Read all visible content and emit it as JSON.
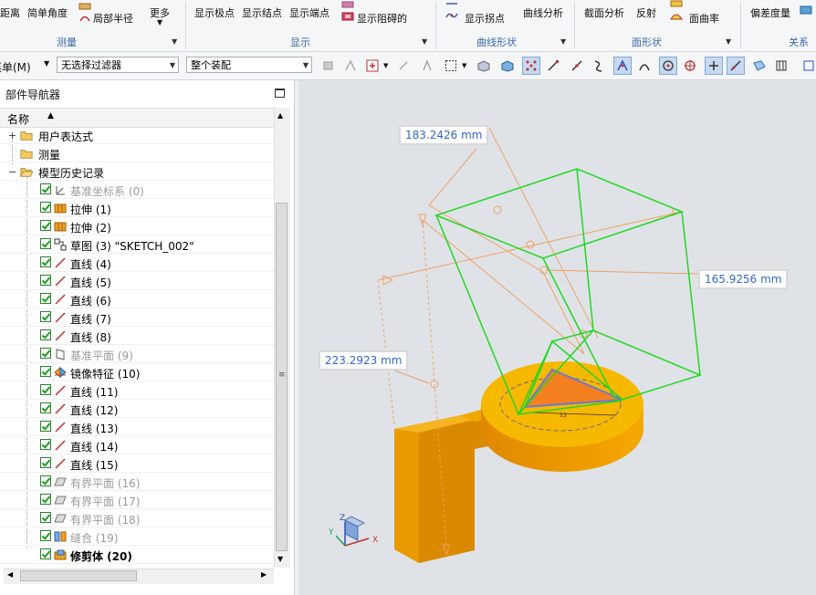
{
  "ribbon": {
    "col1": [
      "距离",
      "简单角度"
    ],
    "col2": [
      "局部半径"
    ],
    "more": "更多",
    "display_items": [
      "显示极点",
      "显示结点",
      "显示端点"
    ],
    "display_extra": "显示阻碍的",
    "curve_items": [
      "显示拐点",
      "曲线分析"
    ],
    "face_items": [
      "截面分析",
      "反射",
      "面曲率"
    ],
    "right_items": [
      "偏差度量"
    ],
    "groups": [
      "测量",
      "显示",
      "曲线形状",
      "面形状",
      "关系"
    ]
  },
  "toolbar": {
    "menu_label": "菜单(M)",
    "filter_value": "无选择过滤器",
    "assembly_value": "整个装配"
  },
  "navigator": {
    "title": "部件导航器",
    "column_name": "名称",
    "top_items": [
      {
        "label": "用户表达式"
      },
      {
        "label": "测量"
      },
      {
        "label": "模型历史记录"
      }
    ],
    "features": [
      {
        "label": "基准坐标系 (0)",
        "icon": "datum-csys-icon",
        "state": "grey"
      },
      {
        "label": "拉伸 (1)",
        "icon": "extrude-icon",
        "state": "normal"
      },
      {
        "label": "拉伸 (2)",
        "icon": "extrude-icon",
        "state": "normal"
      },
      {
        "label": "草图 (3) \"SKETCH_002\"",
        "icon": "sketch-icon",
        "state": "normal"
      },
      {
        "label": "直线 (4)",
        "icon": "line-icon",
        "state": "normal"
      },
      {
        "label": "直线 (5)",
        "icon": "line-icon",
        "state": "normal"
      },
      {
        "label": "直线 (6)",
        "icon": "line-icon",
        "state": "normal"
      },
      {
        "label": "直线 (7)",
        "icon": "line-icon",
        "state": "normal"
      },
      {
        "label": "直线 (8)",
        "icon": "line-icon",
        "state": "normal"
      },
      {
        "label": "基准平面 (9)",
        "icon": "datum-plane-icon",
        "state": "grey"
      },
      {
        "label": "镜像特征 (10)",
        "icon": "mirror-feature-icon",
        "state": "normal"
      },
      {
        "label": "直线 (11)",
        "icon": "line-icon",
        "state": "normal"
      },
      {
        "label": "直线 (12)",
        "icon": "line-icon",
        "state": "normal"
      },
      {
        "label": "直线 (13)",
        "icon": "line-icon",
        "state": "normal"
      },
      {
        "label": "直线 (14)",
        "icon": "line-icon",
        "state": "normal"
      },
      {
        "label": "直线 (15)",
        "icon": "line-icon",
        "state": "normal"
      },
      {
        "label": "有界平面 (16)",
        "icon": "bounded-plane-icon",
        "state": "grey"
      },
      {
        "label": "有界平面 (17)",
        "icon": "bounded-plane-icon",
        "state": "grey"
      },
      {
        "label": "有界平面 (18)",
        "icon": "bounded-plane-icon",
        "state": "grey"
      },
      {
        "label": "缝合 (19)",
        "icon": "sew-icon",
        "state": "grey"
      },
      {
        "label": "修剪体 (20)",
        "icon": "trim-body-icon",
        "state": "bold"
      }
    ]
  },
  "viewport": {
    "dimensions": [
      "183.2426 mm",
      "165.9256 mm",
      "223.2923 mm"
    ],
    "sketch_dim": "53",
    "axis_labels": [
      "X",
      "Y",
      "Z"
    ]
  },
  "colors": {
    "model_orange": "#f5a800",
    "bbox_green": "#22d622",
    "measure_orange": "#f0a060",
    "dimension_text": "#3266c8"
  }
}
